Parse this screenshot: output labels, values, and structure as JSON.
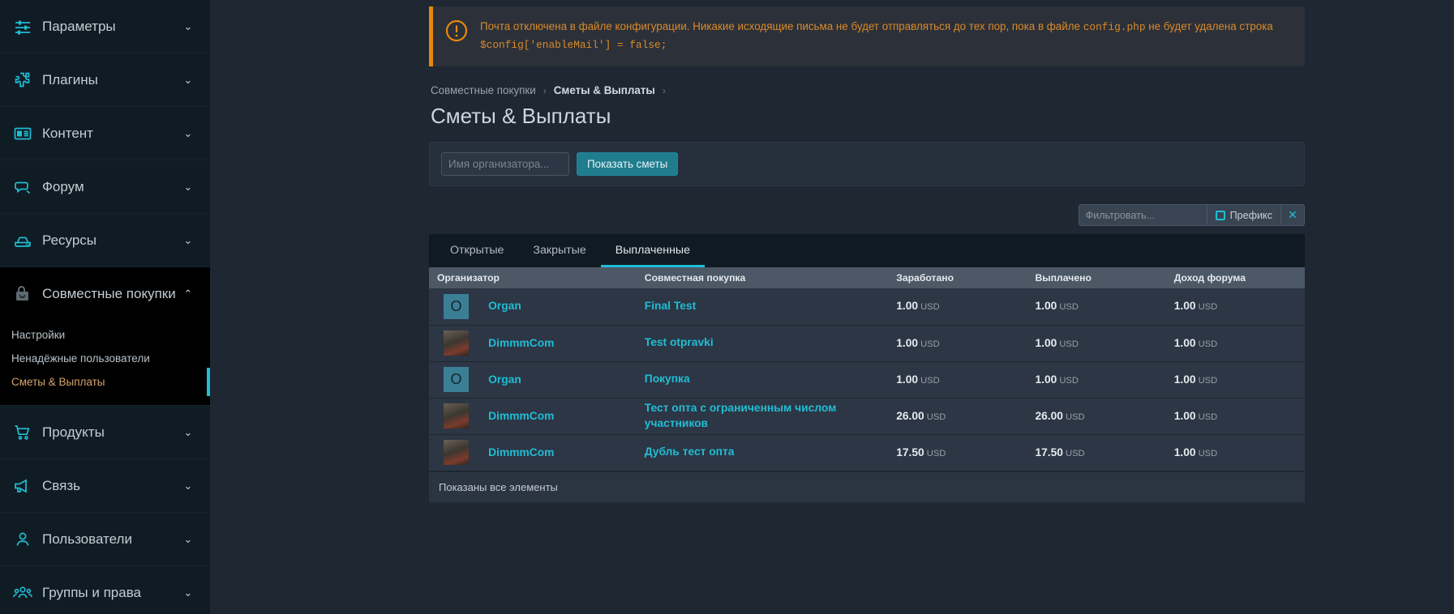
{
  "sidebar": {
    "items": [
      {
        "label": "Параметры",
        "icon": "sliders-icon",
        "expanded": false,
        "chevron": "chevron-down-icon"
      },
      {
        "label": "Плагины",
        "icon": "puzzle-icon",
        "expanded": false,
        "chevron": "chevron-down-icon"
      },
      {
        "label": "Контент",
        "icon": "newspaper-icon",
        "expanded": false,
        "chevron": "chevron-down-icon"
      },
      {
        "label": "Форум",
        "icon": "chat-bubbles-icon",
        "expanded": false,
        "chevron": "chevron-down-icon"
      },
      {
        "label": "Ресурсы",
        "icon": "drive-icon",
        "expanded": false,
        "chevron": "chevron-down-icon"
      },
      {
        "label": "Совместные покупки",
        "icon": "shopping-bag-icon",
        "expanded": true,
        "chevron": "chevron-up-icon"
      },
      {
        "label": "Продукты",
        "icon": "cart-icon",
        "expanded": false,
        "chevron": "chevron-down-icon"
      },
      {
        "label": "Связь",
        "icon": "megaphone-icon",
        "expanded": false,
        "chevron": "chevron-down-icon"
      },
      {
        "label": "Пользователи",
        "icon": "user-icon",
        "expanded": false,
        "chevron": "chevron-down-icon"
      },
      {
        "label": "Группы и права",
        "icon": "users-group-icon",
        "expanded": false,
        "chevron": "chevron-down-icon"
      }
    ],
    "subitems": [
      {
        "label": "Настройки",
        "active": false
      },
      {
        "label": "Ненадёжные пользователи",
        "active": false
      },
      {
        "label": "Сметы & Выплаты",
        "active": true
      }
    ]
  },
  "alert": {
    "icon": "warning-circle-icon",
    "text_part1": "Почта отключена в файле конфигурации. Никакие исходящие письма не будет отправляться до тех пор, пока в файле ",
    "code1": "config.php",
    "text_part2": " не будет удалена строка ",
    "code2": "$config['enableMail'] = false;",
    "accent_color": "#e8890c"
  },
  "breadcrumb": {
    "items": [
      {
        "label": "Совместные покупки",
        "strong": false
      },
      {
        "label": "Сметы & Выплаты",
        "strong": true
      }
    ],
    "separator": "›"
  },
  "page": {
    "title": "Сметы & Выплаты"
  },
  "search": {
    "placeholder": "Имя организатора...",
    "value": "",
    "button_label": "Показать сметы"
  },
  "filter": {
    "placeholder": "Фильтровать...",
    "value": "",
    "prefix_label": "Префикс",
    "prefix_checked": false,
    "clear_icon": "close-icon",
    "clear_label": "✕"
  },
  "tabs": [
    {
      "label": "Открытые",
      "active": false
    },
    {
      "label": "Закрытые",
      "active": false
    },
    {
      "label": "Выплаченные",
      "active": true
    }
  ],
  "table": {
    "columns": [
      "Организатор",
      "Совместная покупка",
      "Заработано",
      "Выплачено",
      "Доход форума"
    ],
    "rows": [
      {
        "avatar_type": "letter",
        "avatar_letter": "O",
        "user": "Organ",
        "purchase": "Final Test",
        "earned": "1.00",
        "earned_cur": "USD",
        "paid": "1.00",
        "paid_cur": "USD",
        "forum": "1.00",
        "forum_cur": "USD"
      },
      {
        "avatar_type": "image",
        "avatar_letter": "",
        "user": "DimmmCom",
        "purchase": "Test otpravki",
        "earned": "1.00",
        "earned_cur": "USD",
        "paid": "1.00",
        "paid_cur": "USD",
        "forum": "1.00",
        "forum_cur": "USD"
      },
      {
        "avatar_type": "letter",
        "avatar_letter": "O",
        "user": "Organ",
        "purchase": "Покупка",
        "earned": "1.00",
        "earned_cur": "USD",
        "paid": "1.00",
        "paid_cur": "USD",
        "forum": "1.00",
        "forum_cur": "USD"
      },
      {
        "avatar_type": "image",
        "avatar_letter": "",
        "user": "DimmmCom",
        "purchase": "Тест опта с ограниченным числом участников",
        "earned": "26.00",
        "earned_cur": "USD",
        "paid": "26.00",
        "paid_cur": "USD",
        "forum": "1.00",
        "forum_cur": "USD"
      },
      {
        "avatar_type": "image",
        "avatar_letter": "",
        "user": "DimmmCom",
        "purchase": "Дубль тест опта",
        "earned": "17.50",
        "earned_cur": "USD",
        "paid": "17.50",
        "paid_cur": "USD",
        "forum": "1.00",
        "forum_cur": "USD"
      }
    ],
    "footer": "Показаны все элементы"
  },
  "colors": {
    "accent": "#21bdd4",
    "warning": "#e8890c",
    "button": "#1f7d8e",
    "sidebar_bg": "#0f1a22",
    "main_bg": "#1f2733"
  }
}
